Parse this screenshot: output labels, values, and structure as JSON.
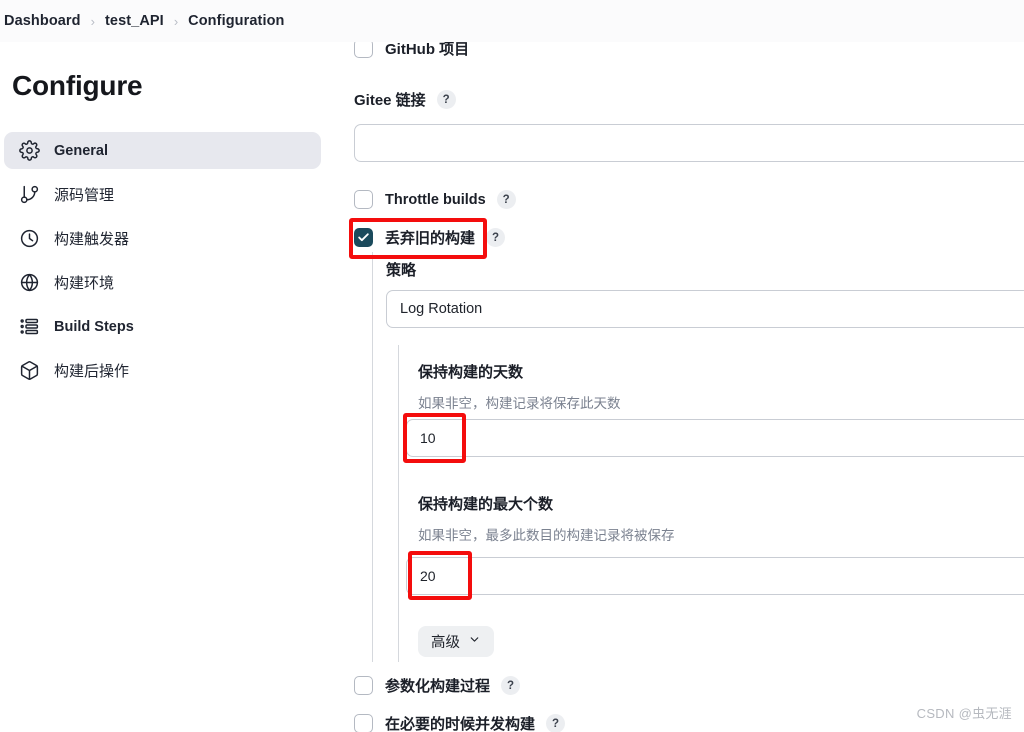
{
  "breadcrumb": {
    "items": [
      "Dashboard",
      "test_API",
      "Configuration"
    ],
    "separator": "›"
  },
  "sidebar": {
    "title": "Configure",
    "items": [
      {
        "label": "General",
        "icon": "gear-icon",
        "active": true
      },
      {
        "label": "源码管理",
        "icon": "git-branch-icon",
        "active": false
      },
      {
        "label": "构建触发器",
        "icon": "clock-icon",
        "active": false
      },
      {
        "label": "构建环境",
        "icon": "globe-icon",
        "active": false
      },
      {
        "label": "Build Steps",
        "icon": "list-steps-icon",
        "active": false
      },
      {
        "label": "构建后操作",
        "icon": "package-icon",
        "active": false
      }
    ]
  },
  "main": {
    "github_project": {
      "label": "GitHub 项目",
      "checked": false
    },
    "gitee_link": {
      "label": "Gitee 链接",
      "help": "?",
      "value": "",
      "placeholder": ""
    },
    "throttle_builds": {
      "label": "Throttle builds",
      "help": "?",
      "checked": false
    },
    "discard_old_builds": {
      "label": "丢弃旧的构建",
      "help": "?",
      "checked": true
    },
    "strategy": {
      "label": "策略",
      "selected": "Log Rotation"
    },
    "days_to_keep": {
      "label": "保持构建的天数",
      "description": "如果非空，构建记录将保存此天数",
      "value": "10"
    },
    "max_builds_to_keep": {
      "label": "保持构建的最大个数",
      "description": "如果非空，最多此数目的构建记录将被保存",
      "value": "20"
    },
    "advanced_button": {
      "label": "高级",
      "icon": "chevron-down-icon"
    },
    "parameterized_build": {
      "label": "参数化构建过程",
      "help": "?",
      "checked": false
    },
    "concurrent_build": {
      "label": "在必要的时候并发构建",
      "help": "?",
      "checked": false
    }
  },
  "annotations": {
    "highlight_color": "#f40d0d",
    "boxes": [
      "discard-old-builds-highlight",
      "days-to-keep-highlight",
      "max-builds-highlight"
    ]
  },
  "watermark": {
    "text": "CSDN @虫无涯"
  },
  "colors": {
    "accent_checkbox": "#1b4a5c",
    "sidebar_active_bg": "#e7e8ee",
    "highlight_red": "#f40d0d",
    "text_primary": "#1b1f28",
    "text_muted": "#7b8290"
  }
}
